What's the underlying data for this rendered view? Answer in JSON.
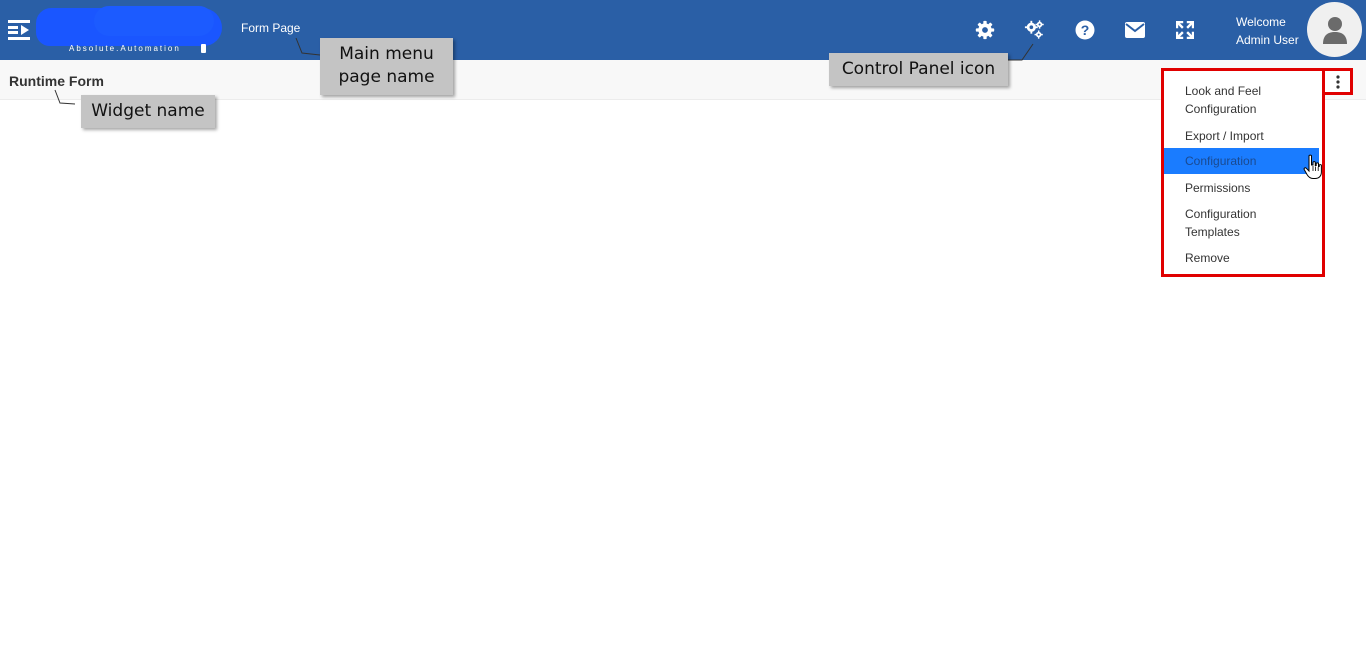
{
  "header": {
    "logo_tagline": "Absolute.Automation",
    "page_name": "Form Page",
    "welcome_line1": "Welcome",
    "welcome_line2": "Admin User",
    "background": "#2a5fa6",
    "icons": [
      "menu-toggle-icon",
      "settings-gear-icon",
      "control-panel-gears-icon",
      "help-question-icon",
      "mail-icon",
      "fullscreen-icon",
      "user-avatar-icon"
    ]
  },
  "widget": {
    "title": "Runtime Form"
  },
  "menu": {
    "items": [
      {
        "line1": "Look and Feel",
        "line2": "Configuration"
      },
      {
        "line1": "Export / Import",
        "line2": ""
      },
      {
        "line1": "Configuration",
        "line2": "",
        "active": true
      },
      {
        "line1": "Permissions",
        "line2": ""
      },
      {
        "line1": "Configuration",
        "line2": "Templates"
      },
      {
        "line1": "Remove",
        "line2": ""
      }
    ],
    "active_color": "#1a7cff",
    "highlight_border": "#e00000"
  },
  "annotations": {
    "main_menu_line1": "Main menu",
    "main_menu_line2": "page name",
    "widget_name": "Widget name",
    "control_panel": "Control Panel icon"
  }
}
